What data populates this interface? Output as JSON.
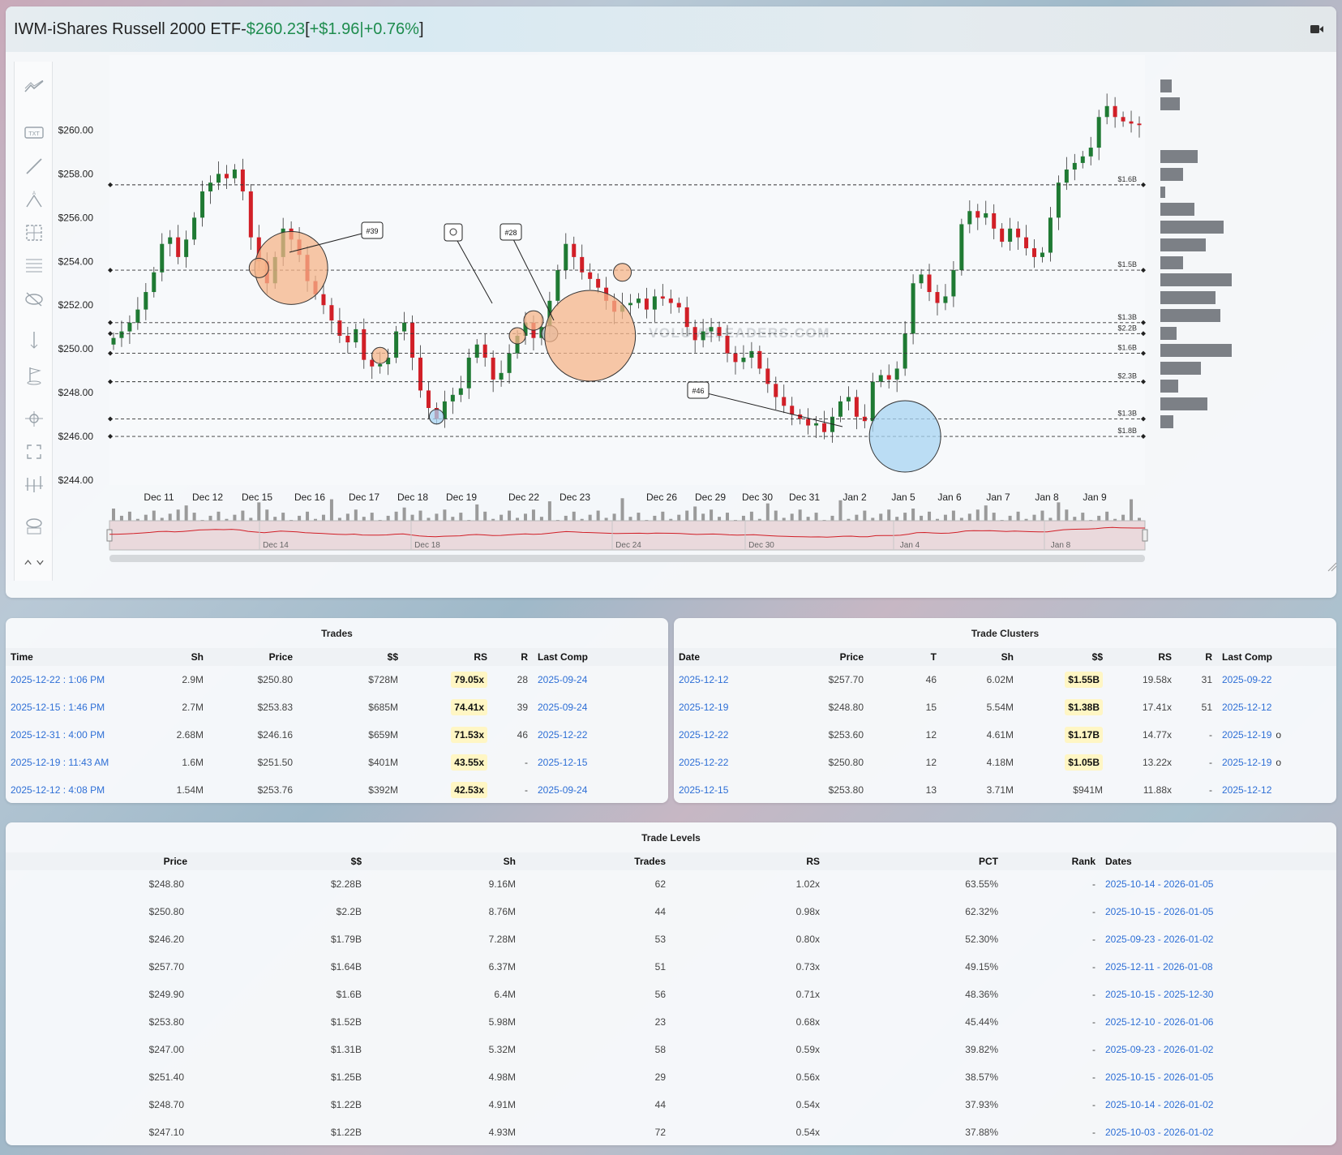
{
  "header": {
    "symbol": "IWM",
    "sep": " - ",
    "name": "iShares Russell 2000 ETF",
    "dash": " - ",
    "price": "$260.23",
    "open_bracket": " [ ",
    "change": "+$1.96",
    "pipe": " | ",
    "pct": "+0.76%",
    "close_bracket": " ]"
  },
  "chart_data": {
    "type": "candlestick",
    "ylim": [
      244,
      261.5
    ],
    "y_ticks": [
      "$260.00",
      "$258.00",
      "$256.00",
      "$254.00",
      "$252.00",
      "$250.00",
      "$248.00",
      "$246.00",
      "$244.00"
    ],
    "x_ticks": [
      "Dec 11",
      "Dec 12",
      "Dec 15",
      "Dec 16",
      "Dec 17",
      "Dec 18",
      "Dec 19",
      "Dec 22",
      "Dec 23",
      "Dec 26",
      "Dec 29",
      "Dec 30",
      "Dec 31",
      "Jan 2",
      "Jan 5",
      "Jan 6",
      "Jan 7",
      "Jan 8",
      "Jan 9"
    ],
    "navigator_ticks": [
      "Dec 14",
      "Dec 18",
      "Dec 24",
      "Dec 30",
      "Jan 4",
      "Jan 8"
    ],
    "watermark": "VOLUMELEADERS.COM",
    "levels": [
      {
        "price": 257.5,
        "label": "$1.6B"
      },
      {
        "price": 253.6,
        "label": "$1.5B"
      },
      {
        "price": 251.2,
        "label": "$1.3B"
      },
      {
        "price": 250.7,
        "label": "$2.2B"
      },
      {
        "price": 249.8,
        "label": "$1.6B"
      },
      {
        "price": 248.5,
        "label": "$2.3B"
      },
      {
        "price": 246.8,
        "label": "$1.3B"
      },
      {
        "price": 246.0,
        "label": "$1.8B"
      }
    ],
    "annotations": [
      "#39",
      "#28",
      "#46"
    ],
    "closes": [
      250.5,
      250.8,
      251.2,
      251.8,
      252.6,
      253.5,
      254.8,
      255.1,
      254.2,
      255.0,
      256.0,
      257.2,
      257.6,
      258.0,
      257.8,
      258.2,
      257.2,
      255.1,
      254.0,
      253.0,
      254.2,
      255.5,
      255.0,
      254.3,
      253.1,
      252.5,
      252.0,
      251.3,
      250.6,
      250.3,
      250.9,
      249.5,
      249.2,
      249.3,
      249.6,
      250.8,
      251.2,
      249.6,
      248.1,
      247.3,
      246.8,
      247.6,
      247.9,
      248.2,
      249.6,
      250.2,
      249.6,
      248.6,
      248.9,
      249.8,
      250.6,
      251.2,
      250.5,
      251.0,
      252.2,
      253.6,
      254.8,
      254.2,
      253.5,
      253.2,
      252.8,
      252.2,
      251.7,
      252.0,
      252.1,
      252.3,
      251.8,
      252.4,
      252.3,
      252.1,
      251.9,
      251.0,
      250.4,
      250.8,
      251.0,
      250.6,
      249.8,
      249.4,
      249.6,
      249.9,
      249.1,
      248.4,
      247.8,
      247.4,
      247.0,
      246.8,
      246.5,
      246.6,
      246.2,
      246.9,
      247.6,
      247.8,
      246.9,
      246.7,
      248.5,
      248.8,
      248.6,
      249.1,
      250.7,
      253.0,
      253.4,
      252.6,
      252.1,
      252.4,
      253.6,
      255.7,
      256.3,
      256.0,
      256.2,
      255.5,
      254.9,
      255.5,
      255.1,
      254.6,
      254.2,
      254.4,
      256.0,
      257.6,
      258.2,
      258.5,
      258.8,
      259.2,
      260.6,
      261.1,
      260.6,
      260.4,
      260.3,
      260.23
    ]
  },
  "trades": {
    "title": "Trades",
    "headers": [
      "Time",
      "Sh",
      "Price",
      "$$",
      "RS",
      "R",
      "Last Comp"
    ],
    "rows": [
      [
        "2025-12-22 : 1:06 PM",
        "2.9M",
        "$250.80",
        "$728M",
        "79.05x",
        "28",
        "2025-09-24"
      ],
      [
        "2025-12-15 : 1:46 PM",
        "2.7M",
        "$253.83",
        "$685M",
        "74.41x",
        "39",
        "2025-09-24"
      ],
      [
        "2025-12-31 : 4:00 PM",
        "2.68M",
        "$246.16",
        "$659M",
        "71.53x",
        "46",
        "2025-12-22"
      ],
      [
        "2025-12-19 : 11:43 AM",
        "1.6M",
        "$251.50",
        "$401M",
        "43.55x",
        "-",
        "2025-12-15"
      ],
      [
        "2025-12-12 : 4:08 PM",
        "1.54M",
        "$253.76",
        "$392M",
        "42.53x",
        "-",
        "2025-09-24"
      ]
    ]
  },
  "clusters": {
    "title": "Trade Clusters",
    "headers": [
      "Date",
      "Price",
      "T",
      "Sh",
      "$$",
      "RS",
      "R",
      "Last Comp"
    ],
    "rows": [
      [
        "2025-12-12",
        "$257.70",
        "46",
        "6.02M",
        "$1.55B",
        "19.58x",
        "31",
        "2025-09-22",
        ""
      ],
      [
        "2025-12-19",
        "$248.80",
        "15",
        "5.54M",
        "$1.38B",
        "17.41x",
        "51",
        "2025-12-12",
        ""
      ],
      [
        "2025-12-22",
        "$253.60",
        "12",
        "4.61M",
        "$1.17B",
        "14.77x",
        "-",
        "2025-12-19",
        "o"
      ],
      [
        "2025-12-22",
        "$250.80",
        "12",
        "4.18M",
        "$1.05B",
        "13.22x",
        "-",
        "2025-12-19",
        "o"
      ],
      [
        "2025-12-15",
        "$253.80",
        "13",
        "3.71M",
        "$941M",
        "11.88x",
        "-",
        "2025-12-12",
        ""
      ]
    ]
  },
  "levels": {
    "title": "Trade Levels",
    "headers": [
      "Price",
      "$$",
      "Sh",
      "Trades",
      "RS",
      "PCT",
      "Rank",
      "Dates"
    ],
    "rows": [
      [
        "$248.80",
        "$2.28B",
        "9.16M",
        "62",
        "1.02x",
        "63.55%",
        "-",
        "2025-10-14 - 2026-01-05"
      ],
      [
        "$250.80",
        "$2.2B",
        "8.76M",
        "44",
        "0.98x",
        "62.32%",
        "-",
        "2025-10-15 - 2026-01-05"
      ],
      [
        "$246.20",
        "$1.79B",
        "7.28M",
        "53",
        "0.80x",
        "52.30%",
        "-",
        "2025-09-23 - 2026-01-02"
      ],
      [
        "$257.70",
        "$1.64B",
        "6.37M",
        "51",
        "0.73x",
        "49.15%",
        "-",
        "2025-12-11 - 2026-01-08"
      ],
      [
        "$249.90",
        "$1.6B",
        "6.4M",
        "56",
        "0.71x",
        "48.36%",
        "-",
        "2025-10-15 - 2025-12-30"
      ],
      [
        "$253.80",
        "$1.52B",
        "5.98M",
        "23",
        "0.68x",
        "45.44%",
        "-",
        "2025-12-10 - 2026-01-06"
      ],
      [
        "$247.00",
        "$1.31B",
        "5.32M",
        "58",
        "0.59x",
        "39.82%",
        "-",
        "2025-09-23 - 2026-01-02"
      ],
      [
        "$251.40",
        "$1.25B",
        "4.98M",
        "29",
        "0.56x",
        "38.57%",
        "-",
        "2025-10-15 - 2026-01-05"
      ],
      [
        "$248.70",
        "$1.22B",
        "4.91M",
        "44",
        "0.54x",
        "37.93%",
        "-",
        "2025-10-14 - 2026-01-02"
      ],
      [
        "$247.10",
        "$1.22B",
        "4.93M",
        "72",
        "0.54x",
        "37.88%",
        "-",
        "2025-10-03 - 2026-01-02"
      ]
    ]
  },
  "colors": {
    "up": "#1f7a33",
    "down": "#d11f27",
    "orange_bubble": "#f5b48a",
    "blue_bubble": "#a7d3f2",
    "link": "#2e6fd6",
    "green_text": "#1e8c4e"
  }
}
